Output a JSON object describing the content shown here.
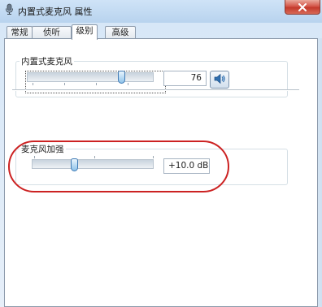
{
  "window": {
    "title": "内置式麦克风 属性",
    "icon": "microphone-properties-icon",
    "close_icon": "close-icon"
  },
  "tabs": [
    {
      "label": "常规",
      "active": false
    },
    {
      "label": "侦听",
      "active": false
    },
    {
      "label": "级别",
      "active": true
    },
    {
      "label": "高级",
      "active": false
    }
  ],
  "microphone": {
    "group_label": "内置式麦克风",
    "level": 76,
    "level_text": "76",
    "speaker_icon": "speaker-icon"
  },
  "boost": {
    "group_label": "麦克风加强",
    "level_fraction": 0.34,
    "value_text": "+10.0 dB"
  },
  "colors": {
    "highlight_ring": "#cc2222",
    "close_button": "#c33a2c",
    "thumb_accent": "#8fc3ea"
  }
}
